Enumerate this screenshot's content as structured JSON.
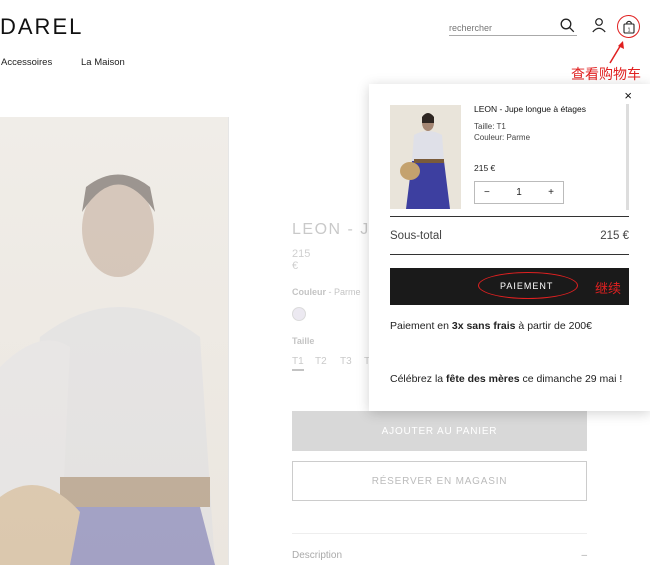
{
  "header": {
    "logo": "DAREL",
    "search_placeholder": "rechercher"
  },
  "nav": {
    "items": [
      "Accessoires",
      "La Maison"
    ]
  },
  "annotations": {
    "cart_note": "查看购物车",
    "pay_note": "继续"
  },
  "product": {
    "title": "LEON - J",
    "price": "215 €",
    "color_label": "Couleur",
    "color_value": " - Parme",
    "size_label": "Taille",
    "sizes": [
      "T1",
      "T2",
      "T3",
      "T"
    ],
    "add_to_cart": "AJOUTER AU PANIER",
    "reserve": "RÉSERVER EN MAGASIN",
    "description_label": "Description",
    "description_toggle": "–"
  },
  "minicart": {
    "close": "×",
    "item": {
      "name": "LEON - Jupe longue à étages",
      "size": "Taille: T1",
      "color": "Couleur:  Parme",
      "price": "215 €",
      "qty": "1",
      "minus": "−",
      "plus": "+"
    },
    "subtotal_label": "Sous-total",
    "subtotal_value": "215 €",
    "pay_button": "PAIEMENT",
    "installments_pre": "Paiement en ",
    "installments_bold": "3x sans frais",
    "installments_post": " à partir de 200€",
    "promo_pre": "Célébrez la ",
    "promo_bold": "fête des mères",
    "promo_post": " ce dimanche 29 mai !"
  },
  "colors": {
    "annotation_red": "#e02020",
    "pay_button_bg": "#1a1a1a",
    "swatch": "#c9c2d9"
  },
  "icons": [
    "search-icon",
    "user-icon",
    "shopping-bag-icon",
    "close-icon",
    "arrow-icon"
  ]
}
